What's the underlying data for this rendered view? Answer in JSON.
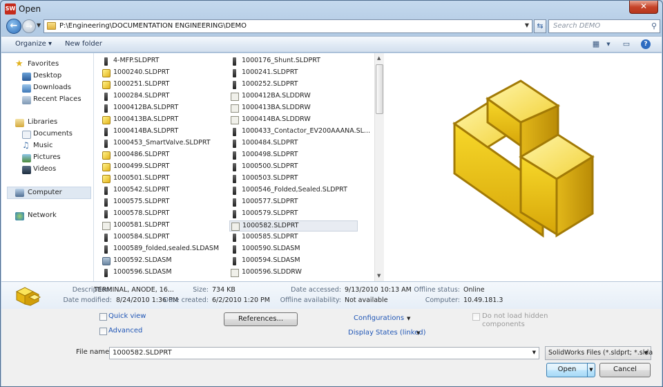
{
  "window": {
    "title": "Open",
    "app_icon_text": "SW",
    "close_glyph": "✕"
  },
  "nav": {
    "back_glyph": "←",
    "forward_glyph": "→",
    "address": "P:\\Engineering\\DOCUMENTATION ENGINEERING\\DEMO",
    "search_placeholder": "Search DEMO"
  },
  "toolbar": {
    "organize_label": "Organize ▾",
    "new_folder_label": "New folder"
  },
  "sidebar": {
    "favorites_label": "Favorites",
    "favorites": [
      "Desktop",
      "Downloads",
      "Recent Places"
    ],
    "libraries_label": "Libraries",
    "libraries": [
      "Documents",
      "Music",
      "Pictures",
      "Videos"
    ],
    "computer_label": "Computer",
    "network_label": "Network"
  },
  "files": {
    "col1": [
      {
        "name": "4-MFP.SLDPRT",
        "icon": "body"
      },
      {
        "name": "1000240.SLDPRT",
        "icon": "part"
      },
      {
        "name": "1000251.SLDPRT",
        "icon": "part"
      },
      {
        "name": "1000284.SLDPRT",
        "icon": "body"
      },
      {
        "name": "1000412BA.SLDPRT",
        "icon": "body"
      },
      {
        "name": "1000413BA.SLDPRT",
        "icon": "part"
      },
      {
        "name": "1000414BA.SLDPRT",
        "icon": "body"
      },
      {
        "name": "1000453_SmartValve.SLDPRT",
        "icon": "body"
      },
      {
        "name": "1000486.SLDPRT",
        "icon": "part"
      },
      {
        "name": "1000499.SLDPRT",
        "icon": "part"
      },
      {
        "name": "1000501.SLDPRT",
        "icon": "part"
      },
      {
        "name": "1000542.SLDPRT",
        "icon": "body"
      },
      {
        "name": "1000575.SLDPRT",
        "icon": "body"
      },
      {
        "name": "1000578.SLDPRT",
        "icon": "body"
      },
      {
        "name": "1000581.SLDPRT",
        "icon": "drw"
      },
      {
        "name": "1000584.SLDPRT",
        "icon": "body"
      },
      {
        "name": "1000589_folded,sealed.SLDASM",
        "icon": "body"
      },
      {
        "name": "1000592.SLDASM",
        "icon": "asm"
      },
      {
        "name": "1000596.SLDASM",
        "icon": "body"
      }
    ],
    "col2": [
      {
        "name": "1000176_Shunt.SLDPRT",
        "icon": "body"
      },
      {
        "name": "1000241.SLDPRT",
        "icon": "body"
      },
      {
        "name": "1000252.SLDPRT",
        "icon": "body"
      },
      {
        "name": "1000412BA.SLDDRW",
        "icon": "drw"
      },
      {
        "name": "1000413BA.SLDDRW",
        "icon": "drw"
      },
      {
        "name": "1000414BA.SLDDRW",
        "icon": "drw"
      },
      {
        "name": "1000433_Contactor_EV200AAANA.SL...",
        "icon": "body"
      },
      {
        "name": "1000484.SLDPRT",
        "icon": "body"
      },
      {
        "name": "1000498.SLDPRT",
        "icon": "body"
      },
      {
        "name": "1000500.SLDPRT",
        "icon": "body"
      },
      {
        "name": "1000503.SLDPRT",
        "icon": "body"
      },
      {
        "name": "1000546_Folded,Sealed.SLDPRT",
        "icon": "body"
      },
      {
        "name": "1000577.SLDPRT",
        "icon": "body"
      },
      {
        "name": "1000579.SLDPRT",
        "icon": "body"
      },
      {
        "name": "1000582.SLDPRT",
        "icon": "drw",
        "selected": true
      },
      {
        "name": "1000585.SLDPRT",
        "icon": "body"
      },
      {
        "name": "1000590.SLDASM",
        "icon": "body"
      },
      {
        "name": "1000594.SLDASM",
        "icon": "body"
      },
      {
        "name": "1000596.SLDDRW",
        "icon": "drw"
      }
    ]
  },
  "details": {
    "description_label": "Description:",
    "description": "TERMINAL, ANODE, 16...",
    "size_label": "Size:",
    "size": "734 KB",
    "accessed_label": "Date accessed:",
    "accessed": "9/13/2010 10:13 AM",
    "offline_status_label": "Offline status:",
    "offline_status": "Online",
    "modified_label": "Date modified:",
    "modified": "8/24/2010 1:36 PM",
    "created_label": "Date created:",
    "created": "6/2/2010 1:20 PM",
    "availability_label": "Offline availability:",
    "availability": "Not available",
    "computer_label": "Computer:",
    "computer": "10.49.181.3"
  },
  "options": {
    "quick_view": "Quick view",
    "advanced": "Advanced",
    "references": "References...",
    "configurations": "Configurations",
    "display_states": "Display States (linked)",
    "hidden_components_line1": "Do not load hidden",
    "hidden_components_line2": "components"
  },
  "file_name": {
    "label": "File name:",
    "value": "1000582.SLDPRT"
  },
  "file_type": {
    "value": "SolidWorks Files (*.sldprt; *.slda"
  },
  "buttons": {
    "open": "Open",
    "cancel": "Cancel"
  }
}
